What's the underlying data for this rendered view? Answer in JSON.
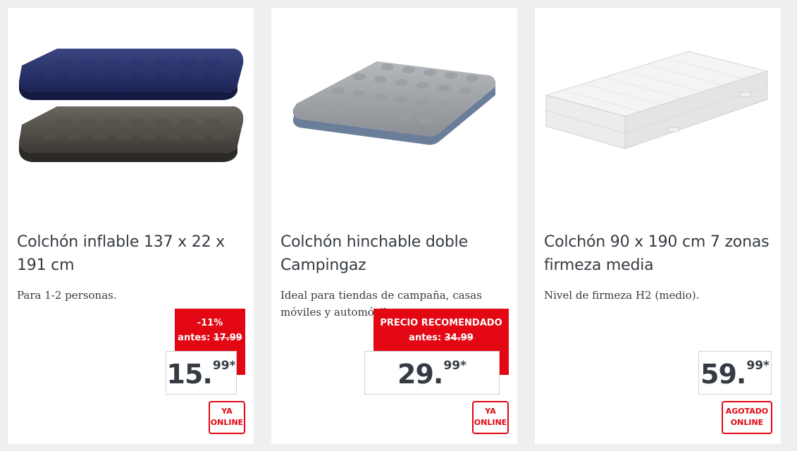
{
  "products": [
    {
      "title": "Colchón inflable 137 x 22 x 191 cm",
      "description": "Para 1-2 personas.",
      "discount": "-11%",
      "before_label": "antes:",
      "before_price": "17.99",
      "price_int": "15.",
      "price_dec": "99*",
      "badge_line1": "YA",
      "badge_line2": "ONLINE",
      "image": "inflatable-mattress-blue-and-grey"
    },
    {
      "title": "Colchón hinchable doble Campingaz",
      "description": "Ideal para tiendas de campaña, casas móviles y automóviles.",
      "recommended_label": "PRECIO RECOMENDADO",
      "before_label": "antes:",
      "before_price": "34.99",
      "price_int": "29.",
      "price_dec": "99*",
      "badge_line1": "YA",
      "badge_line2": "ONLINE",
      "image": "grey-inflatable-mattress"
    },
    {
      "title": "Colchón 90 x 190 cm 7 zonas firmeza media",
      "description": "Nivel de firmeza H2 (medio).",
      "price_int": "59.",
      "price_dec": "99*",
      "badge_line1": "AGOTADO",
      "badge_line2": "ONLINE",
      "image": "white-foam-mattress"
    }
  ],
  "colors": {
    "accent": "#e30613",
    "text": "#353b42",
    "background": "#eeeff1",
    "card": "#ffffff"
  }
}
